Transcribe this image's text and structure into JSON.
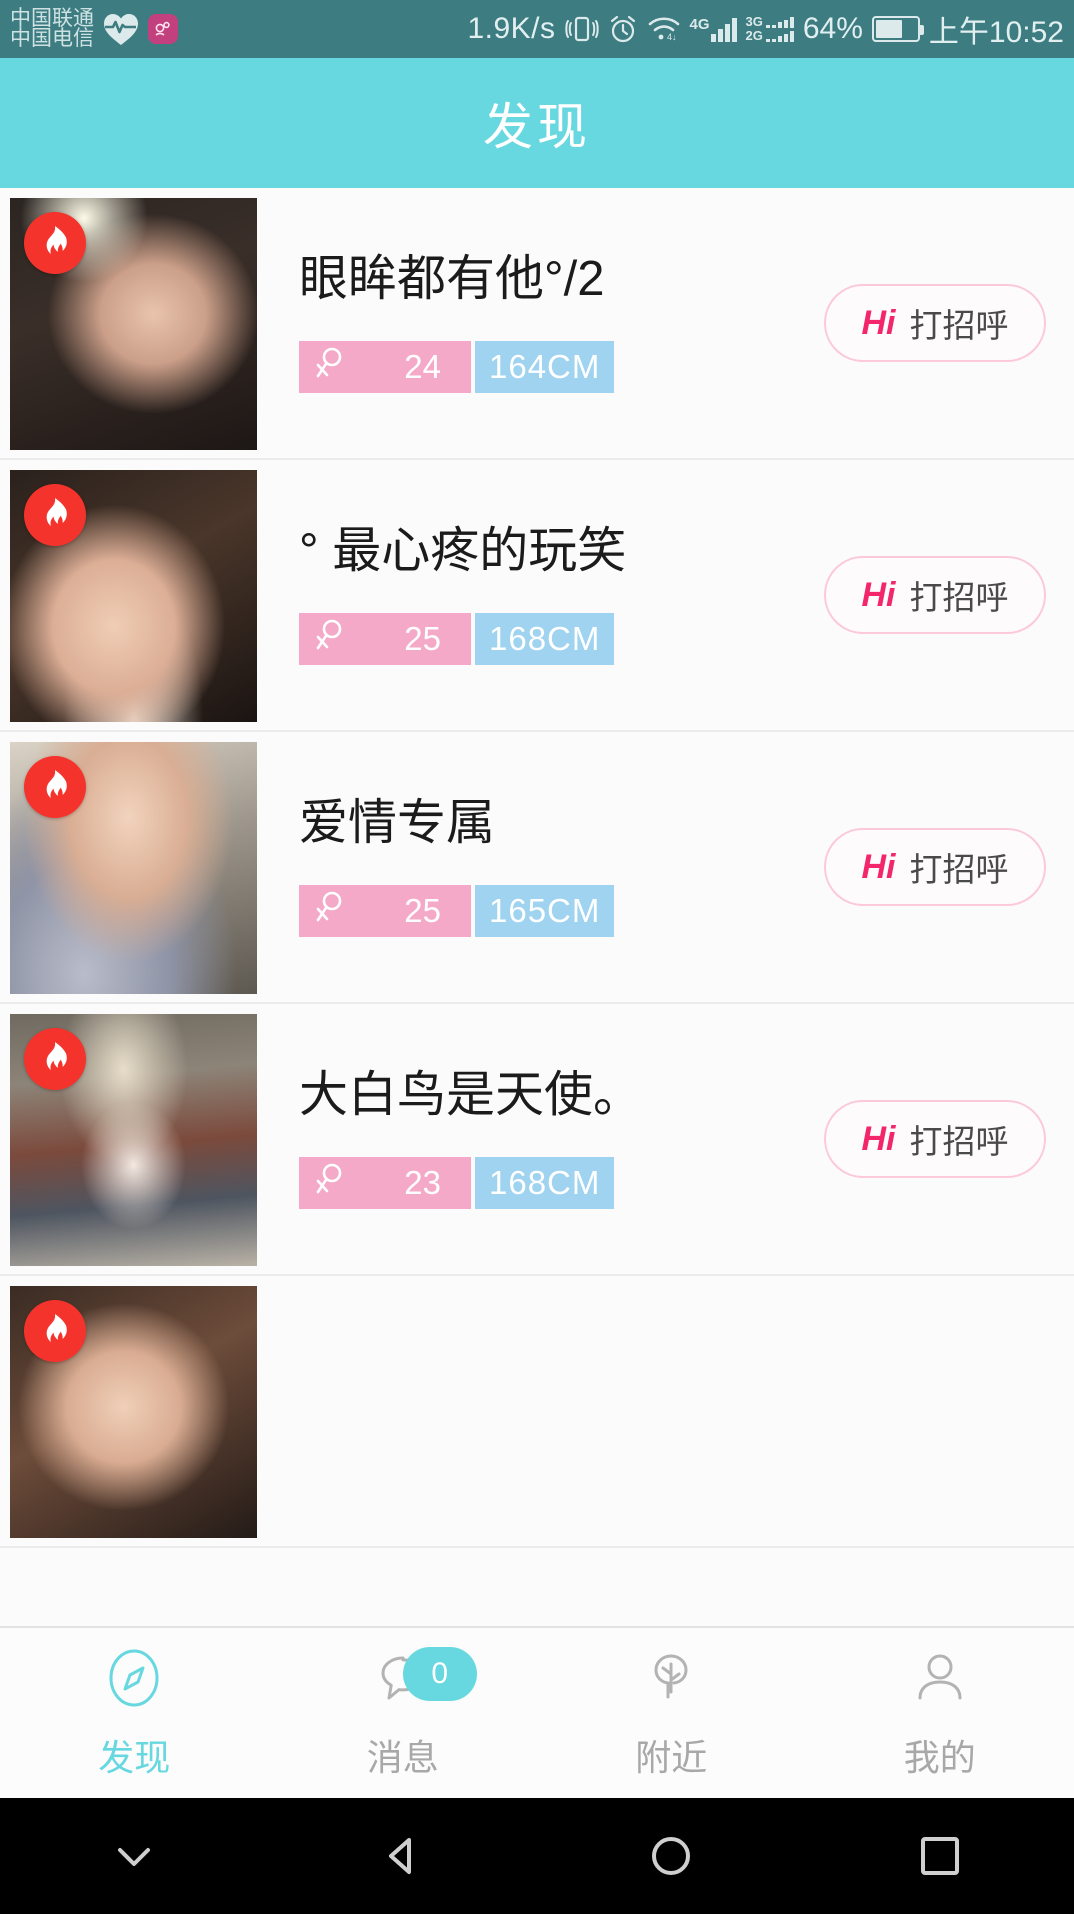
{
  "statusbar": {
    "carrier_primary": "中国联通",
    "carrier_secondary": "中国电信",
    "heart_icon": "heart-rate-icon",
    "app_icon": "pink-app-icon",
    "net_speed": "1.9K/s",
    "vibrate_icon": "vibrate-icon",
    "alarm_icon": "alarm-clock-icon",
    "wifi_icon": "wifi-icon",
    "signal_4g_label": "4G",
    "signal_3g_label": "3G",
    "signal_2g_label": "2G",
    "battery_percent": "64%",
    "time": "上午10:52"
  },
  "header": {
    "title": "发现"
  },
  "list": {
    "hi_label_en": "Hi",
    "hi_label_zh": "打招呼",
    "gender_icon": "female-gender-icon",
    "hot_icon": "flame-icon",
    "items": [
      {
        "nickname": "眼眸都有他°/2",
        "age": "24",
        "height": "164CM"
      },
      {
        "nickname": "° 最心疼的玩笑",
        "age": "25",
        "height": "168CM"
      },
      {
        "nickname": "爱情专属",
        "age": "25",
        "height": "165CM"
      },
      {
        "nickname": "大白鸟是天使。",
        "age": "23",
        "height": "168CM"
      }
    ]
  },
  "tabbar": {
    "tabs": [
      {
        "label": "发现",
        "icon": "compass-icon",
        "active": true
      },
      {
        "label": "消息",
        "icon": "chat-bubble-icon",
        "badge": "0",
        "active": false
      },
      {
        "label": "附近",
        "icon": "tree-location-icon",
        "active": false
      },
      {
        "label": "我的",
        "icon": "person-icon",
        "active": false
      }
    ]
  },
  "navbar": {
    "back_icon": "chevron-down-icon",
    "triangle_icon": "back-triangle-icon",
    "home_icon": "home-circle-icon",
    "recents_icon": "recents-square-icon"
  },
  "colors": {
    "accent": "#67d7e0",
    "statusbar_bg": "#3d7d82",
    "pink_tag": "#f4a9c8",
    "blue_tag": "#9fd3f0",
    "hi_pink": "#f4266b",
    "flame_red": "#f4342c"
  }
}
